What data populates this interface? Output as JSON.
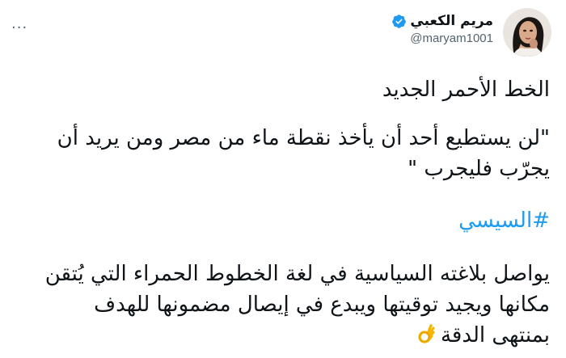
{
  "author": {
    "name": "مريم الكعبي",
    "handle": "@maryam1001",
    "verified": true
  },
  "menu_icon_text": "···",
  "tweet": {
    "title": "الخط الأحمر الجديد",
    "quote_line1": "\"لن يستطيع أحد أن يأخذ نقطة ماء من مصر ومن يريد أن",
    "quote_line2": "يجرّب فليجرب \"",
    "hashtag": "#السيسي",
    "para_line1": "يواصل بلاغته السياسية في لغة الخطوط الحمراء التي يُتقن",
    "para_line2": "مكانها ويجيد توقيتها ويبدع في إيصال مضمونها للهدف",
    "para_line3": "بمنتهى الدقة"
  },
  "colors": {
    "link": "#1d9bf0",
    "text": "#0f1419",
    "secondary": "#536471",
    "verified": "#1d9bf0"
  },
  "icons": {
    "verified": "verified-badge-icon",
    "more": "more-options-icon",
    "emoji": "ok-hand-emoji-icon"
  }
}
